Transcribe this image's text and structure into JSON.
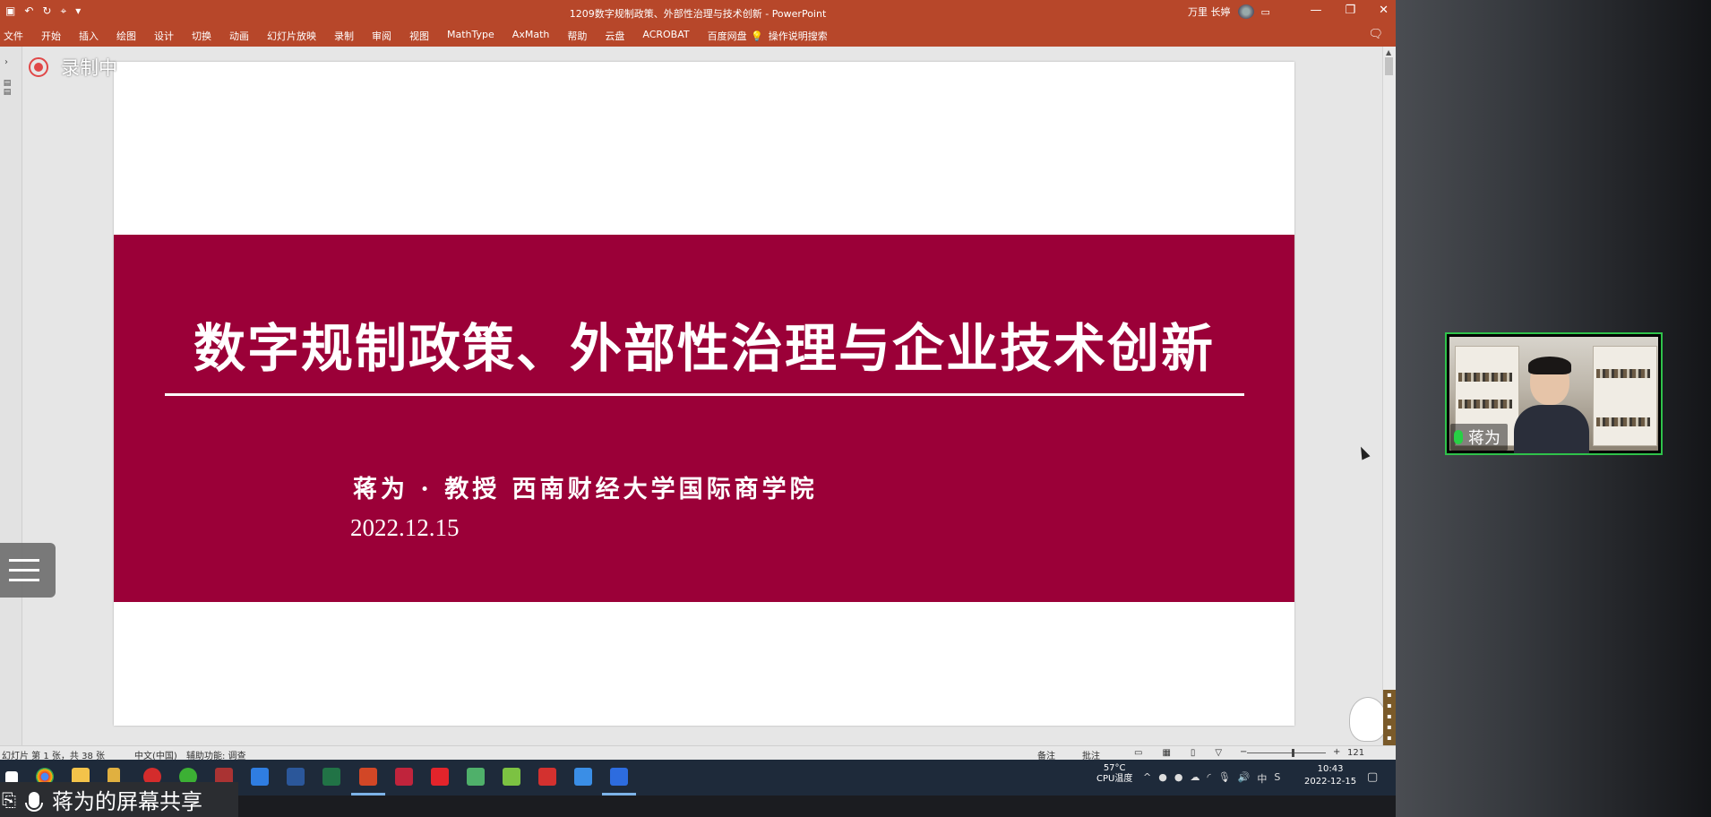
{
  "window": {
    "title": "1209数字规制政策、外部性治理与技术创新  -  PowerPoint",
    "user_name": "万里 长婷"
  },
  "ribbon": {
    "tabs": [
      "文件",
      "开始",
      "插入",
      "绘图",
      "设计",
      "切换",
      "动画",
      "幻灯片放映",
      "录制",
      "审阅",
      "视图",
      "MathType",
      "AxMath",
      "帮助",
      "云盘",
      "ACROBAT",
      "百度网盘"
    ],
    "tell_me": "操作说明搜索"
  },
  "recording": {
    "label": "录制中",
    "color": "#e04848"
  },
  "slide": {
    "title": "数字规制政策、外部性治理与企业技术创新",
    "author": "蒋为 · 教授 西南财经大学国际商学院",
    "date": "2022.12.15",
    "band_color": "#9b0038"
  },
  "statusbar": {
    "slide_info": "幻灯片 第 1 张，共 38 张",
    "language": "中文(中国)",
    "accessibility": "辅助功能: 调查",
    "notes": "备注",
    "comments": "批注",
    "zoom": "121"
  },
  "taskbar": {
    "weather_temp": "57°C",
    "weather_label": "CPU温度",
    "ime": "中",
    "time": "10:43",
    "date": "2022-12-15"
  },
  "share": {
    "label": "蒋为的屏幕共享"
  },
  "video": {
    "participant": "蒋为",
    "border_color": "#2fc24a"
  }
}
